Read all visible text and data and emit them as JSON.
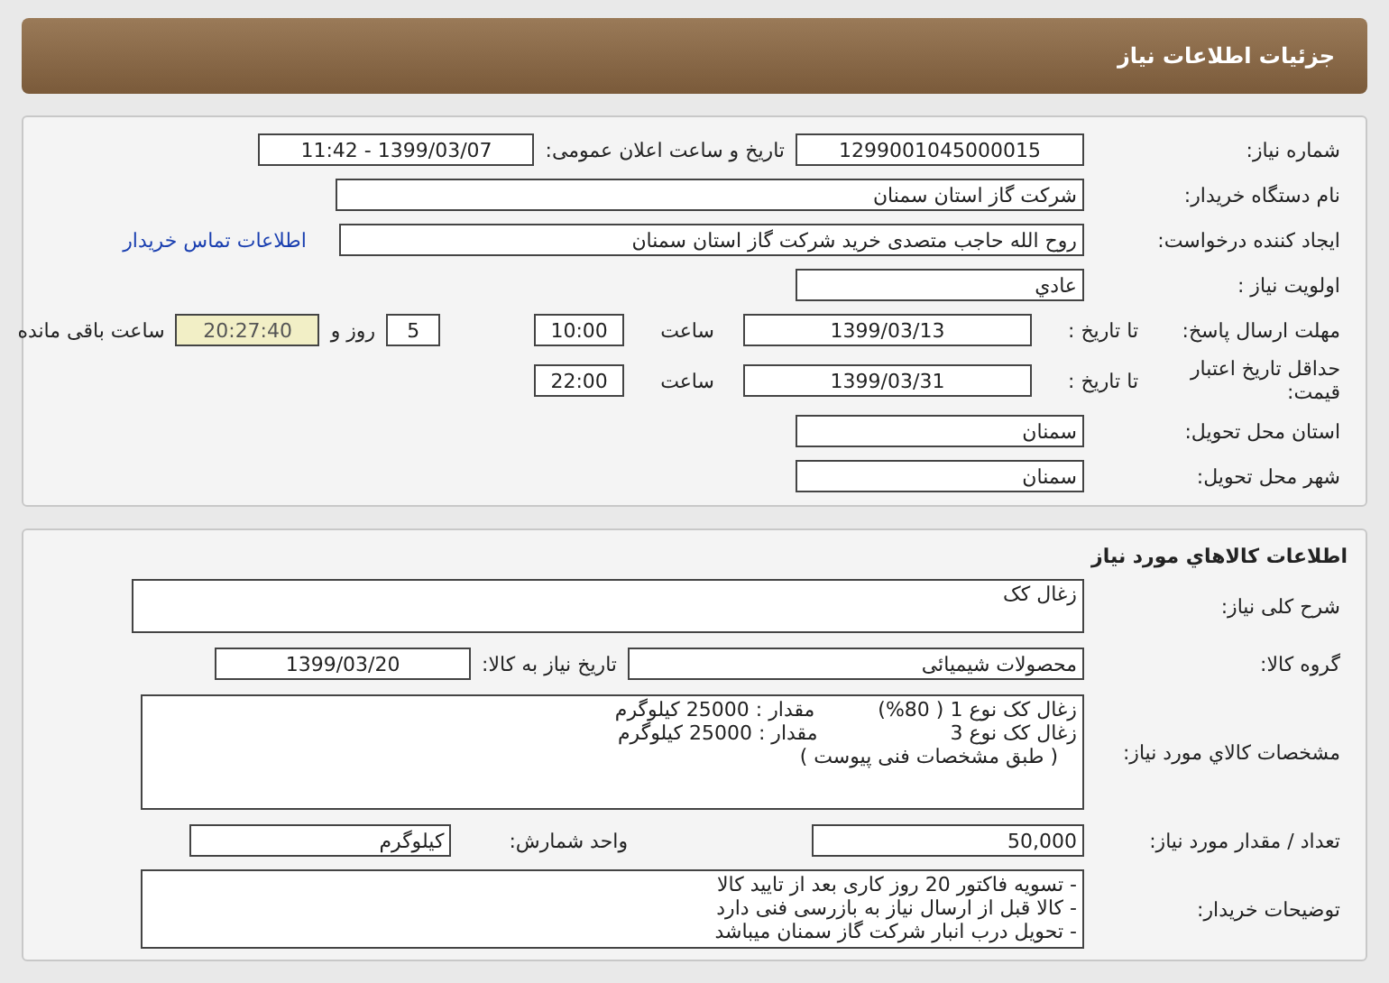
{
  "header": {
    "title": "جزئیات اطلاعات نیاز"
  },
  "need_info": {
    "need_number": {
      "label": "شماره نیاز:",
      "value": "1299001045000015"
    },
    "announce": {
      "label": "تاریخ و ساعت اعلان عمومی:",
      "value": "1399/03/07 - 11:42"
    },
    "buyer": {
      "label": "نام دستگاه خریدار:",
      "value": "شرکت گاز استان سمنان"
    },
    "creator": {
      "label": "ایجاد کننده درخواست:",
      "value": "روح الله  حاجب متصدی خرید شرکت گاز استان سمنان",
      "link": "اطلاعات تماس خریدار"
    },
    "priority": {
      "label": "اولویت نیاز :",
      "value": "عادي"
    },
    "deadline": {
      "label": "مهلت ارسال پاسخ:",
      "to_date_label": "تا تاریخ :",
      "date": "1399/03/13",
      "time_label": "ساعت",
      "time": "10:00",
      "days": "5",
      "days_label": "روز و",
      "remaining": "20:27:40",
      "remaining_label": "ساعت باقی مانده"
    },
    "validity": {
      "label": "حداقل تاریخ اعتبار قیمت:",
      "to_date_label": "تا تاریخ :",
      "date": "1399/03/31",
      "time_label": "ساعت",
      "time": "22:00"
    },
    "province": {
      "label": "استان محل تحویل:",
      "value": "سمنان"
    },
    "city": {
      "label": "شهر محل تحویل:",
      "value": "سمنان"
    }
  },
  "goods": {
    "title": "اطلاعات کالاهاي مورد نیاز",
    "description": {
      "label": "شرح کلی نیاز:",
      "value": "زغال کک"
    },
    "group": {
      "label": "گروه کالا:",
      "value": "محصولات شیمیائی",
      "date_label": "تاریخ نیاز به کالا:",
      "date": "1399/03/20"
    },
    "specs": {
      "label": "مشخصات کالاي مورد نیاز:",
      "lines": [
        "زغال کک نوع 1 ( 80%)          مقدار : 25000 کیلوگرم",
        "زغال کک نوع 3                     مقدار : 25000 کیلوگرم",
        "   ( طبق مشخصات فنی پیوست )"
      ]
    },
    "quantity": {
      "label": "تعداد / مقدار مورد نیاز:",
      "value": "50,000",
      "unit_label": "واحد شمارش:",
      "unit": "کیلوگرم"
    },
    "notes": {
      "label": "توضیحات خریدار:",
      "lines": [
        "- تسویه فاکتور 20 روز کاری بعد از تایید کالا",
        "- کالا قبل از ارسال نیاز به بازرسی فنی دارد",
        "- تحویل درب انبار شرکت گاز سمنان میباشد"
      ]
    }
  }
}
